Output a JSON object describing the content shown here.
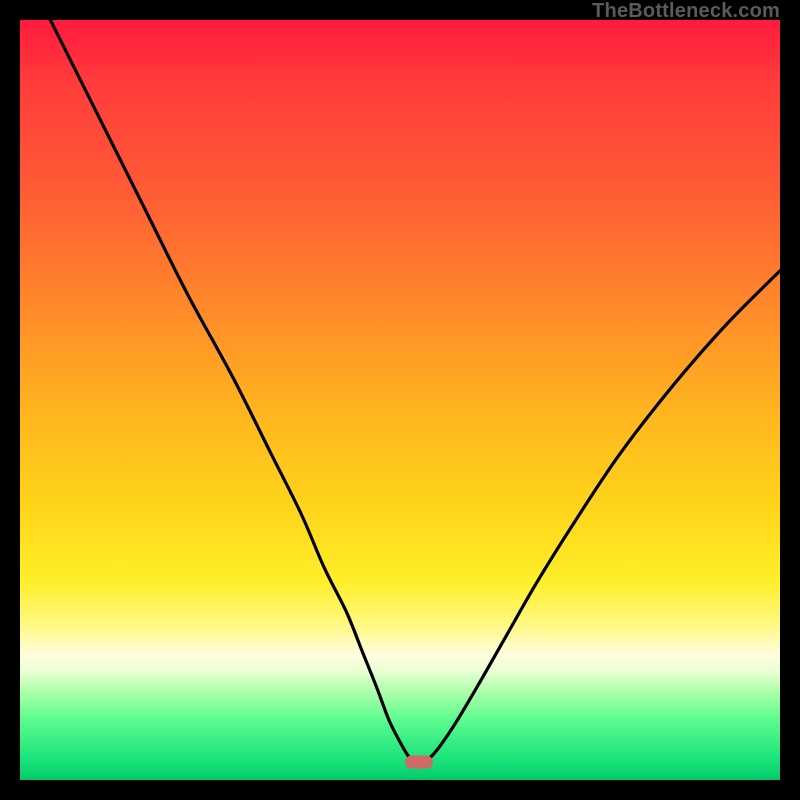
{
  "watermark": "TheBottleneck.com",
  "marker": {
    "x_pct": 52.5,
    "y_pct": 97.6,
    "color": "#cf6a66"
  },
  "chart_data": {
    "type": "line",
    "title": "",
    "xlabel": "",
    "ylabel": "",
    "xlim": [
      0,
      100
    ],
    "ylim": [
      0,
      100
    ],
    "grid": false,
    "legend": false,
    "series": [
      {
        "name": "bottleneck-curve",
        "x": [
          4,
          10,
          16,
          22,
          28,
          33,
          37,
          40,
          43,
          45,
          47,
          48.5,
          50,
          51.2,
          52,
          53,
          54.5,
          57,
          60,
          64,
          68,
          73,
          79,
          86,
          93,
          100
        ],
        "y": [
          100,
          88,
          76,
          64,
          53,
          43,
          35,
          28,
          22,
          17,
          12,
          8,
          5,
          3,
          2.4,
          2.4,
          3.5,
          7,
          12,
          19,
          26,
          34,
          43,
          52,
          60,
          67
        ]
      }
    ],
    "annotations": [
      {
        "type": "marker",
        "shape": "pill",
        "x": 52.5,
        "y": 2.4,
        "color": "#cf6a66"
      }
    ]
  }
}
